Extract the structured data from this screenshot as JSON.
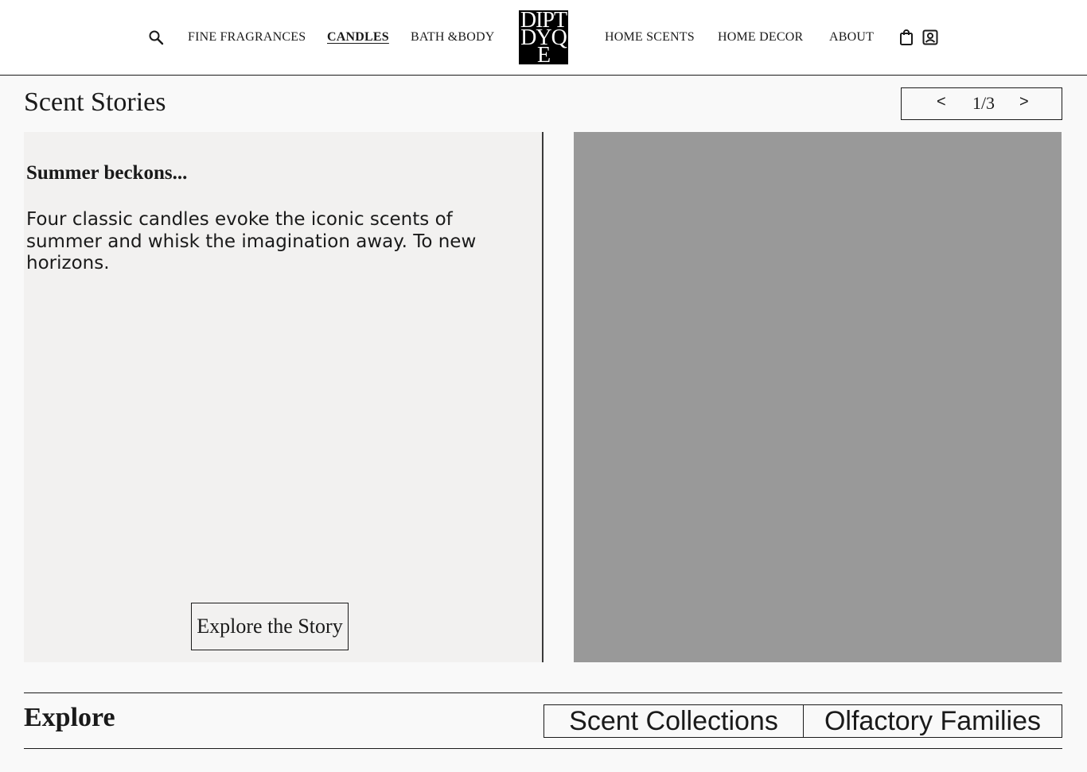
{
  "header": {
    "nav_left": [
      {
        "label": "FINE FRAGRANCES",
        "active": false
      },
      {
        "label": "CANDLES",
        "active": true
      },
      {
        "label": "BATH &BODY",
        "active": false
      }
    ],
    "nav_right": [
      {
        "label": "HOME SCENTS",
        "active": false
      },
      {
        "label": "HOME DECOR",
        "active": false
      },
      {
        "label": "ABOUT",
        "active": false
      }
    ],
    "logo_lines": [
      "DIPT",
      "DYQ",
      "E"
    ],
    "icons": [
      "search-icon",
      "shopping-bag-icon",
      "account-icon"
    ]
  },
  "scent_stories": {
    "title": "Scent Stories",
    "pager": {
      "prev": "<",
      "count": "1/3",
      "next": ">"
    },
    "story": {
      "heading": "Summer beckons...",
      "body": "Four classic candles evoke the iconic scents of summer and whisk the imagination away. To new horizons.",
      "cta": "Explore the Story"
    }
  },
  "explore": {
    "title": "Explore",
    "tabs": [
      "Scent Collections",
      "Olfactory Families"
    ]
  },
  "colors": {
    "page_background": "#f9f9f9",
    "card_background": "#f2f1f0",
    "image_placeholder": "#999999",
    "ink": "#1a1a1a"
  }
}
